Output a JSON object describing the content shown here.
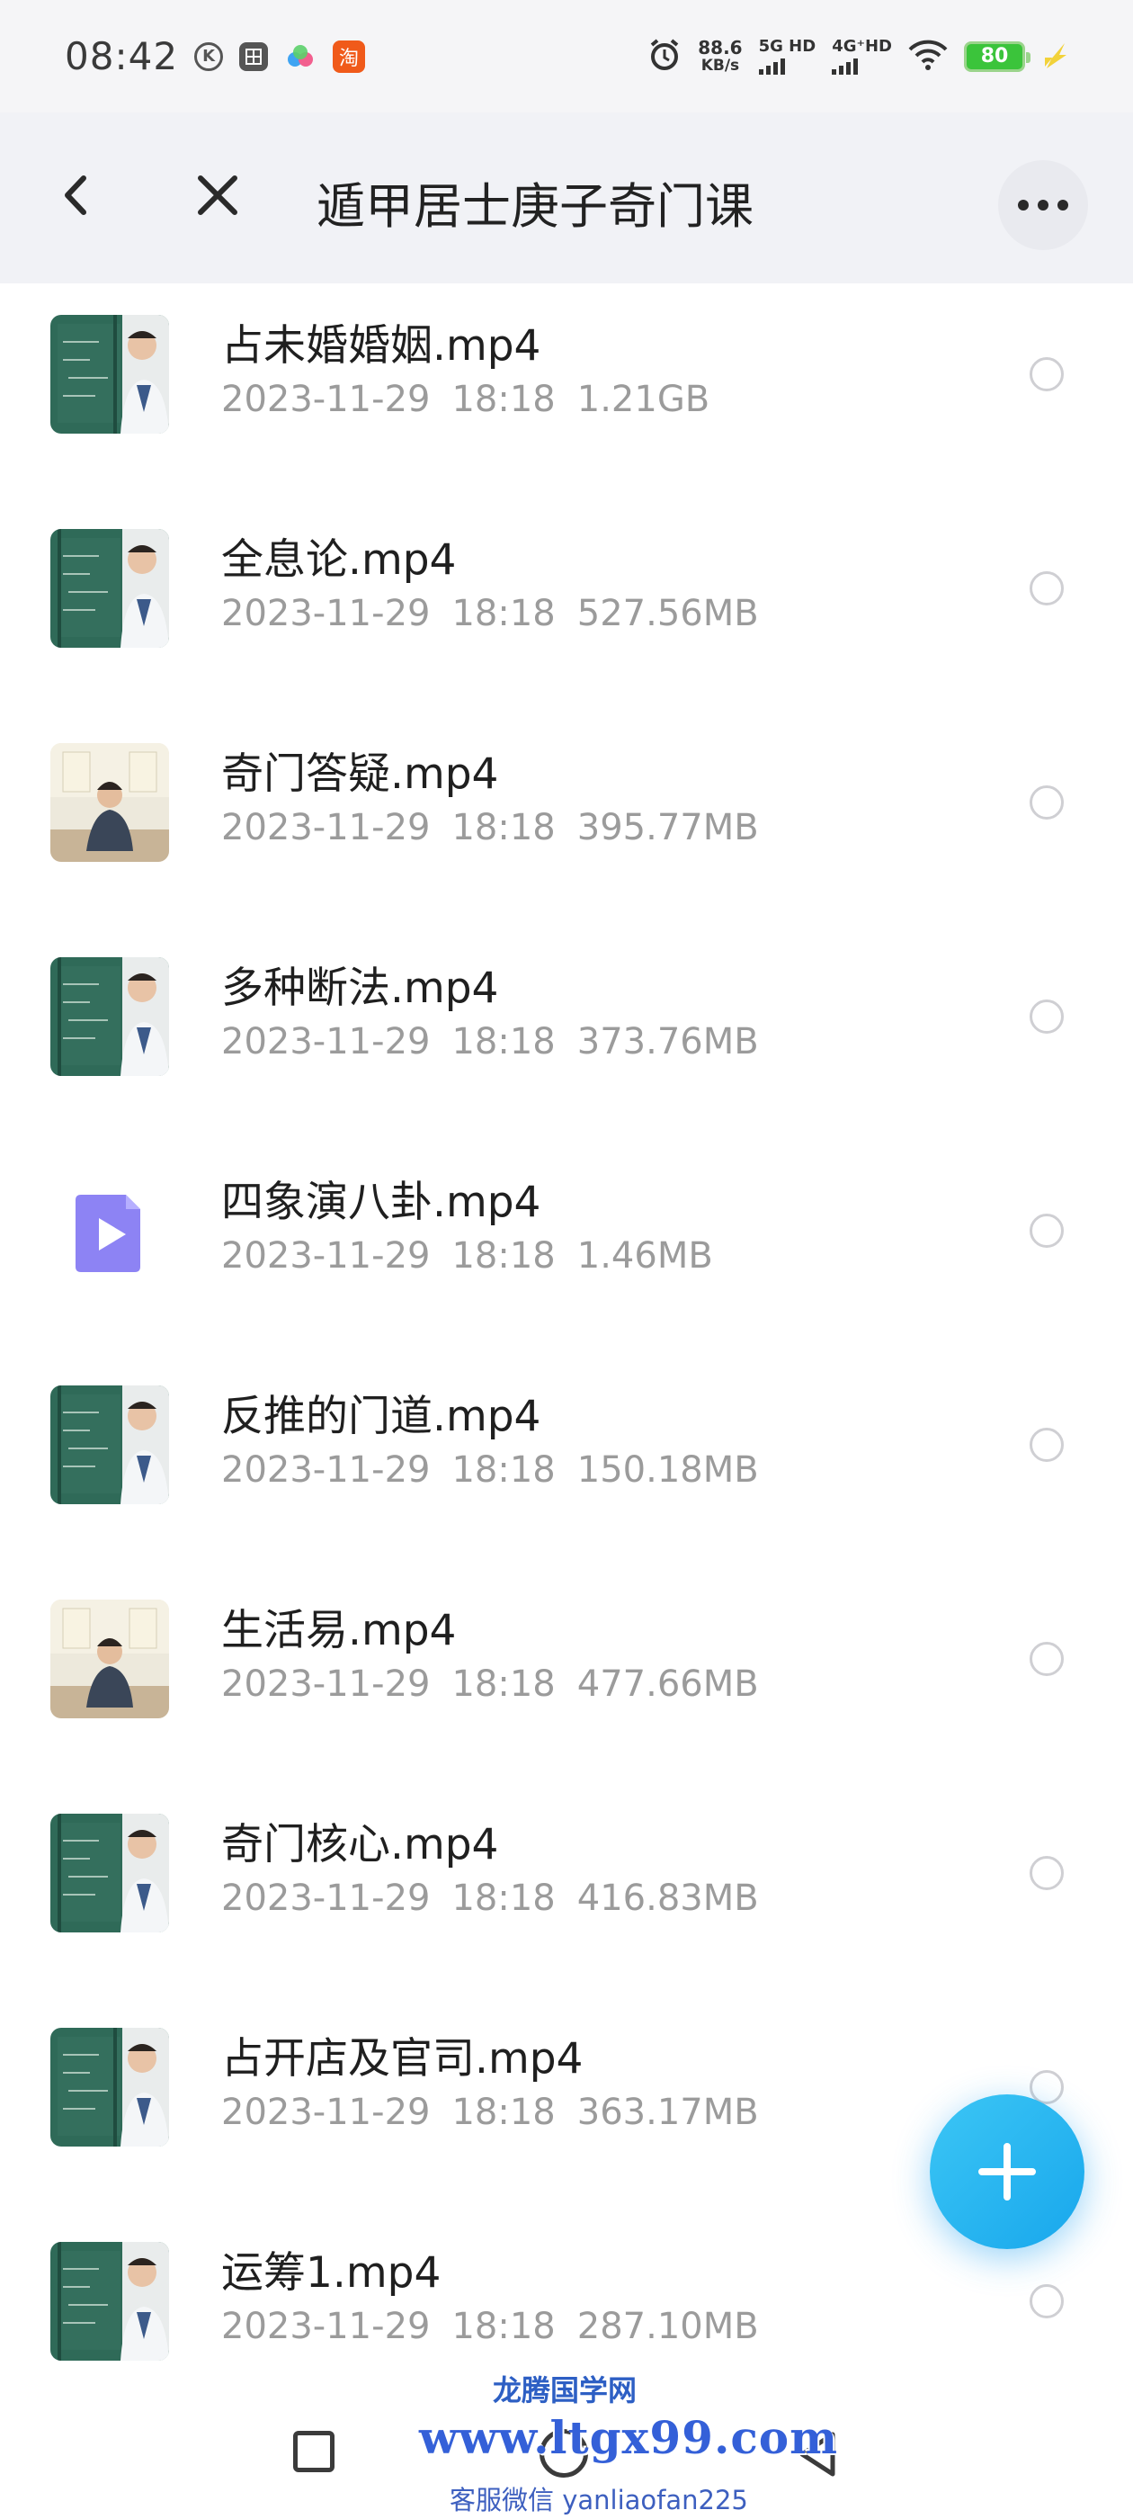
{
  "status_bar": {
    "time": "08:42",
    "net_speed": "88.6",
    "net_unit": "KB/s",
    "sim1": "5G HD",
    "sim2": "4G⁺HD",
    "battery": "80",
    "icons": [
      "k-circle-icon",
      "cube-icon",
      "cloud-icon",
      "taobao-icon",
      "alarm-icon",
      "wifi-icon",
      "battery-icon",
      "charging-icon"
    ],
    "taobao_glyph": "淘"
  },
  "header": {
    "title": "遁甲居士庚子奇门课",
    "back_icon": "chevron-left-icon",
    "close_icon": "close-icon",
    "more_icon": "more-icon"
  },
  "files": [
    {
      "name": "占未婚婚姻.mp4",
      "date": "2023-11-29",
      "time": "18:18",
      "size": "1.21GB",
      "thumb": "blackboard-teacher"
    },
    {
      "name": "全息论.mp4",
      "date": "2023-11-29",
      "time": "18:18",
      "size": "527.56MB",
      "thumb": "blackboard-teacher"
    },
    {
      "name": "奇门答疑.mp4",
      "date": "2023-11-29",
      "time": "18:18",
      "size": "395.77MB",
      "thumb": "seated-teacher"
    },
    {
      "name": "多种断法.mp4",
      "date": "2023-11-29",
      "time": "18:18",
      "size": "373.76MB",
      "thumb": "blackboard-teacher"
    },
    {
      "name": "四象演八卦.mp4",
      "date": "2023-11-29",
      "time": "18:18",
      "size": "1.46MB",
      "thumb": "video-icon"
    },
    {
      "name": "反推的门道.mp4",
      "date": "2023-11-29",
      "time": "18:18",
      "size": "150.18MB",
      "thumb": "blackboard-teacher"
    },
    {
      "name": "生活易.mp4",
      "date": "2023-11-29",
      "time": "18:18",
      "size": "477.66MB",
      "thumb": "seated-teacher"
    },
    {
      "name": "奇门核心.mp4",
      "date": "2023-11-29",
      "time": "18:18",
      "size": "416.83MB",
      "thumb": "blackboard-teacher"
    },
    {
      "name": "占开店及官司.mp4",
      "date": "2023-11-29",
      "time": "18:18",
      "size": "363.17MB",
      "thumb": "blackboard-teacher"
    },
    {
      "name": "运筹1.mp4",
      "date": "2023-11-29",
      "time": "18:18",
      "size": "287.10MB",
      "thumb": "blackboard-teacher"
    }
  ],
  "fab": {
    "icon": "plus-icon"
  },
  "nav": {
    "home_icon": "square-icon",
    "center_icon": "circle-icon",
    "back_icon": "triangle-back-icon"
  },
  "watermark": {
    "line1": "龙腾国学网",
    "line2": "www.ltgx99.com",
    "line3": "客服微信 yanliaofan225"
  },
  "colors": {
    "accent": "#1aa9ee",
    "header_bg": "#f1f2f6",
    "meta_text": "#9b9b9b",
    "watermark": "#3460d8"
  }
}
